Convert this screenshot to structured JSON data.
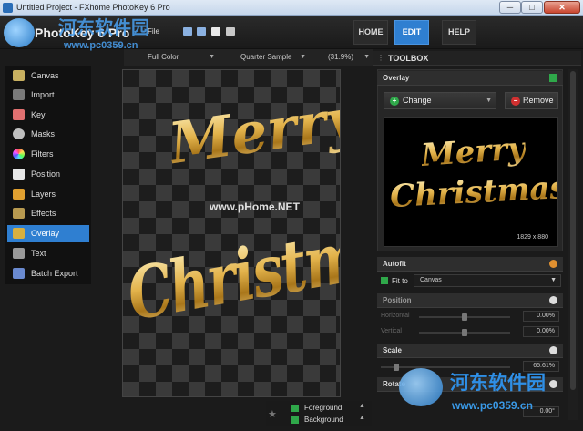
{
  "window": {
    "title": "Untitled Project - FXhome PhotoKey 6 Pro",
    "min_label": "─",
    "max_label": "□",
    "close_label": "✕"
  },
  "app": {
    "logo_text": "PhotoKey 6 Pro",
    "file_menu": "File"
  },
  "nav": [
    {
      "label": "HOME",
      "active": false
    },
    {
      "label": "EDIT",
      "active": true
    },
    {
      "label": "HELP",
      "active": false
    }
  ],
  "sidebar": {
    "items": [
      {
        "label": "Canvas",
        "icon": "canvas-icon",
        "color": "#c8b060"
      },
      {
        "label": "Import",
        "icon": "import-icon",
        "color": "#7a7a7a"
      },
      {
        "label": "Key",
        "icon": "key-icon",
        "color": "#e07070"
      },
      {
        "label": "Masks",
        "icon": "masks-icon",
        "color": "#bfbfbf"
      },
      {
        "label": "Filters",
        "icon": "filters-icon",
        "color": "#d86ad0"
      },
      {
        "label": "Position",
        "icon": "position-icon",
        "color": "#e6e6e6"
      },
      {
        "label": "Layers",
        "icon": "layers-icon",
        "color": "#e0a030"
      },
      {
        "label": "Effects",
        "icon": "effects-icon",
        "color": "#b89a50"
      },
      {
        "label": "Overlay",
        "icon": "overlay-icon",
        "color": "#d8b040"
      },
      {
        "label": "Text",
        "icon": "text-icon",
        "color": "#9a9a9a"
      },
      {
        "label": "Batch Export",
        "icon": "batch-export-icon",
        "color": "#6a8ad0"
      }
    ],
    "active_index": 8
  },
  "canvas_bar": {
    "color_mode": "Full Color",
    "sample": "Quarter Sample",
    "zoom": "(31.9%)"
  },
  "canvas": {
    "line1": "Merry",
    "line2": "Christmas"
  },
  "layers": {
    "foreground": "Foreground",
    "background": "Background"
  },
  "toolbox": {
    "title": "TOOLBOX",
    "overlay": {
      "title": "Overlay",
      "change_label": "Change",
      "remove_label": "Remove",
      "preview_line1": "Merry",
      "preview_line2": "Christmas",
      "dimensions": "1829 x 880"
    },
    "autofit": {
      "title": "Autofit",
      "fit_label": "Fit to",
      "fit_value": "Canvas"
    },
    "position": {
      "title": "Position",
      "horizontal_label": "Horizontal",
      "horizontal_value": "0.00%",
      "vertical_label": "Vertical",
      "vertical_value": "0.00%"
    },
    "scale": {
      "title": "Scale",
      "value": "65.61%"
    },
    "rotate": {
      "title": "Rotate",
      "value": "0.00°"
    }
  },
  "watermark": {
    "cn": "河东软件园",
    "url": "www.pc0359.cn",
    "mid": "www.pHome.NET"
  }
}
